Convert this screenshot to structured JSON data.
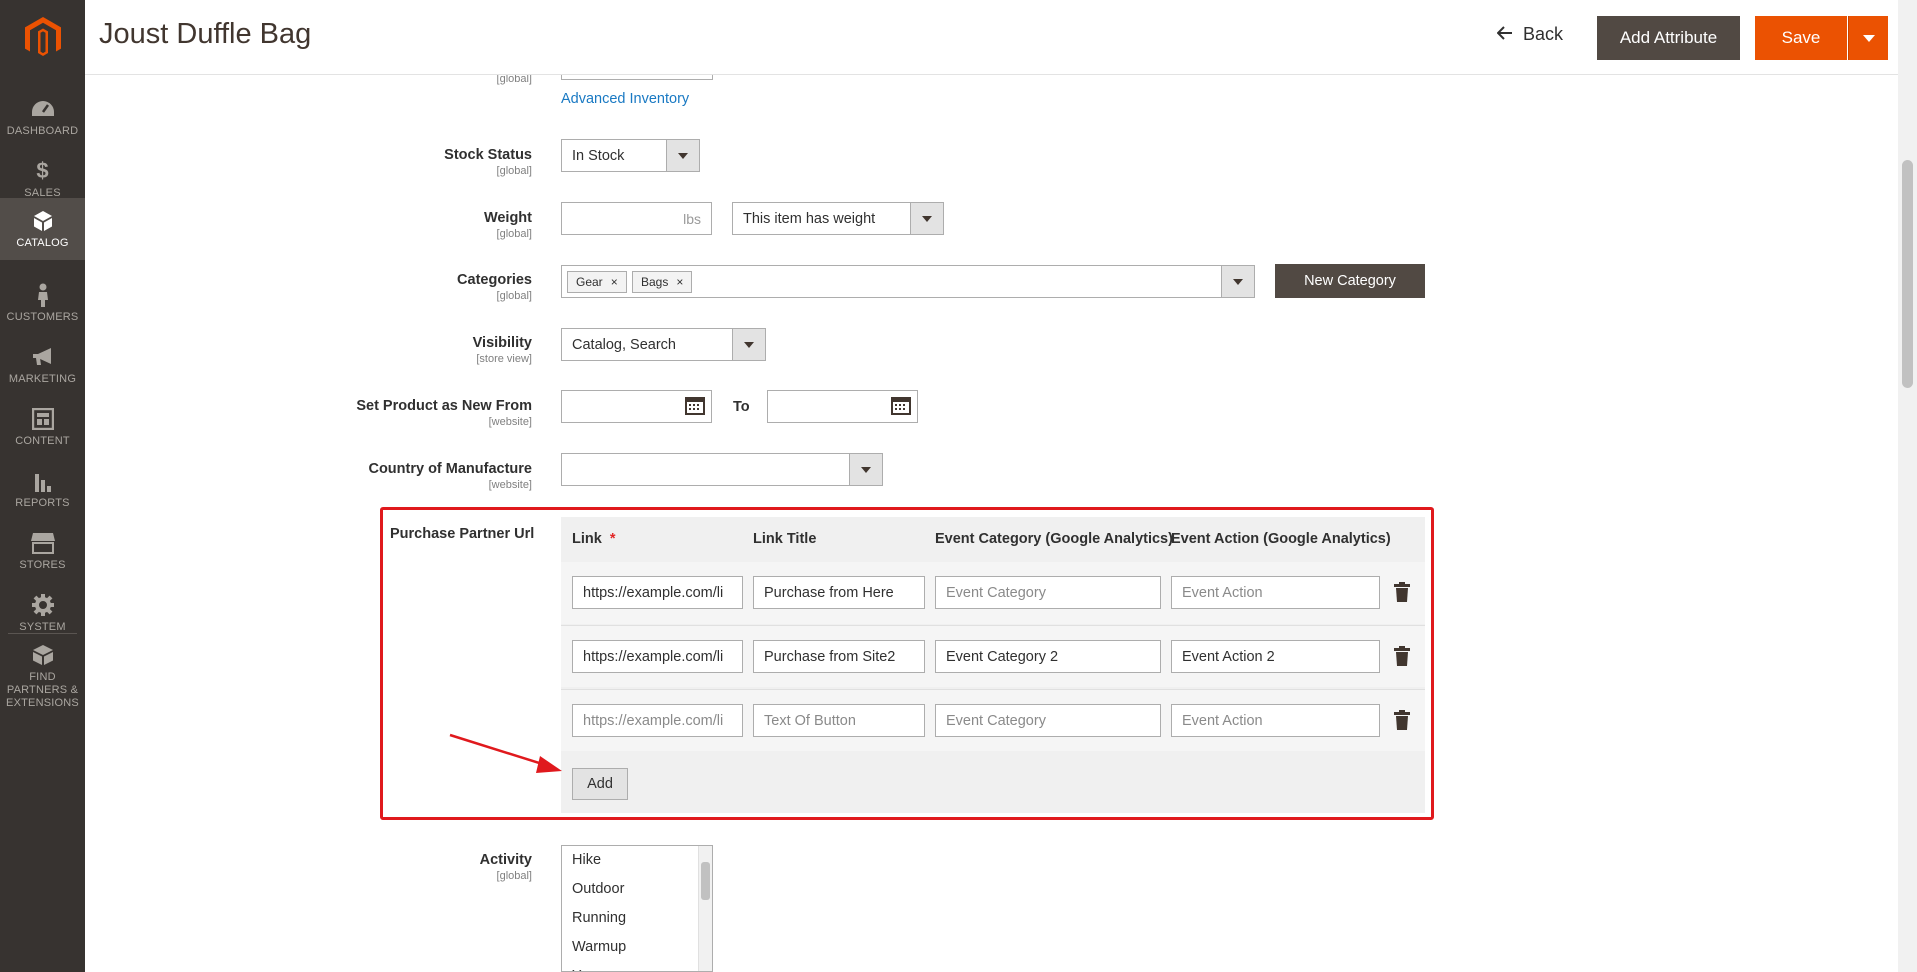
{
  "app": {
    "title": "Joust Duffle Bag"
  },
  "header": {
    "back_label": "Back",
    "add_attribute_label": "Add Attribute",
    "save_label": "Save"
  },
  "sidebar": {
    "items": [
      {
        "label": "Dashboard",
        "icon": "dashboard-icon"
      },
      {
        "label": "Sales",
        "icon": "dollar-icon"
      },
      {
        "label": "Catalog",
        "icon": "cube-icon",
        "active": true
      },
      {
        "label": "Customers",
        "icon": "person-icon"
      },
      {
        "label": "Marketing",
        "icon": "megaphone-icon"
      },
      {
        "label": "Content",
        "icon": "layout-icon"
      },
      {
        "label": "Reports",
        "icon": "bar-chart-icon"
      },
      {
        "label": "Stores",
        "icon": "storefront-icon"
      },
      {
        "label": "System",
        "icon": "gear-icon"
      },
      {
        "label": "Find Partners & Extensions",
        "icon": "boxes-icon"
      }
    ]
  },
  "form": {
    "top_scope": "[global]",
    "advanced_inventory": "Advanced Inventory",
    "stock_status": {
      "label": "Stock Status",
      "scope": "[global]",
      "value": "In Stock"
    },
    "weight": {
      "label": "Weight",
      "scope": "[global]",
      "unit": "lbs",
      "type_value": "This item has weight"
    },
    "categories": {
      "label": "Categories",
      "scope": "[global]",
      "tags": [
        "Gear",
        "Bags"
      ],
      "new_category": "New Category"
    },
    "visibility": {
      "label": "Visibility",
      "scope": "[store view]",
      "value": "Catalog, Search"
    },
    "new_from": {
      "label": "Set Product as New From",
      "scope": "[website]",
      "to_label": "To"
    },
    "country": {
      "label": "Country of Manufacture",
      "scope": "[website]",
      "value": ""
    },
    "purchase_partner": {
      "label": "Purchase Partner Url",
      "headers": {
        "link": "Link",
        "required_mark": "*",
        "title": "Link Title",
        "category": "Event Category (Google Analytics)",
        "action": "Event Action (Google Analytics)"
      },
      "rows": [
        {
          "link": "https://example.com/li",
          "title": "Purchase from Here",
          "category": "Event Category",
          "action": "Event Action",
          "link_ph": false,
          "title_ph": false,
          "category_ph": true,
          "action_ph": true
        },
        {
          "link": "https://example.com/li",
          "title": "Purchase from Site2",
          "category": "Event Category 2",
          "action": "Event Action 2",
          "link_ph": false,
          "title_ph": false,
          "category_ph": false,
          "action_ph": false
        },
        {
          "link": "https://example.com/li",
          "title": "Text Of Button",
          "category": "Event Category",
          "action": "Event Action",
          "link_ph": true,
          "title_ph": true,
          "category_ph": true,
          "action_ph": true
        }
      ],
      "add_label": "Add"
    },
    "activity": {
      "label": "Activity",
      "scope": "[global]",
      "options": [
        "Hike",
        "Outdoor",
        "Running",
        "Warmup",
        "Y"
      ]
    }
  },
  "colors": {
    "accent": "#eb5202",
    "highlight": "#e0191d",
    "sidebar": "#373330"
  }
}
